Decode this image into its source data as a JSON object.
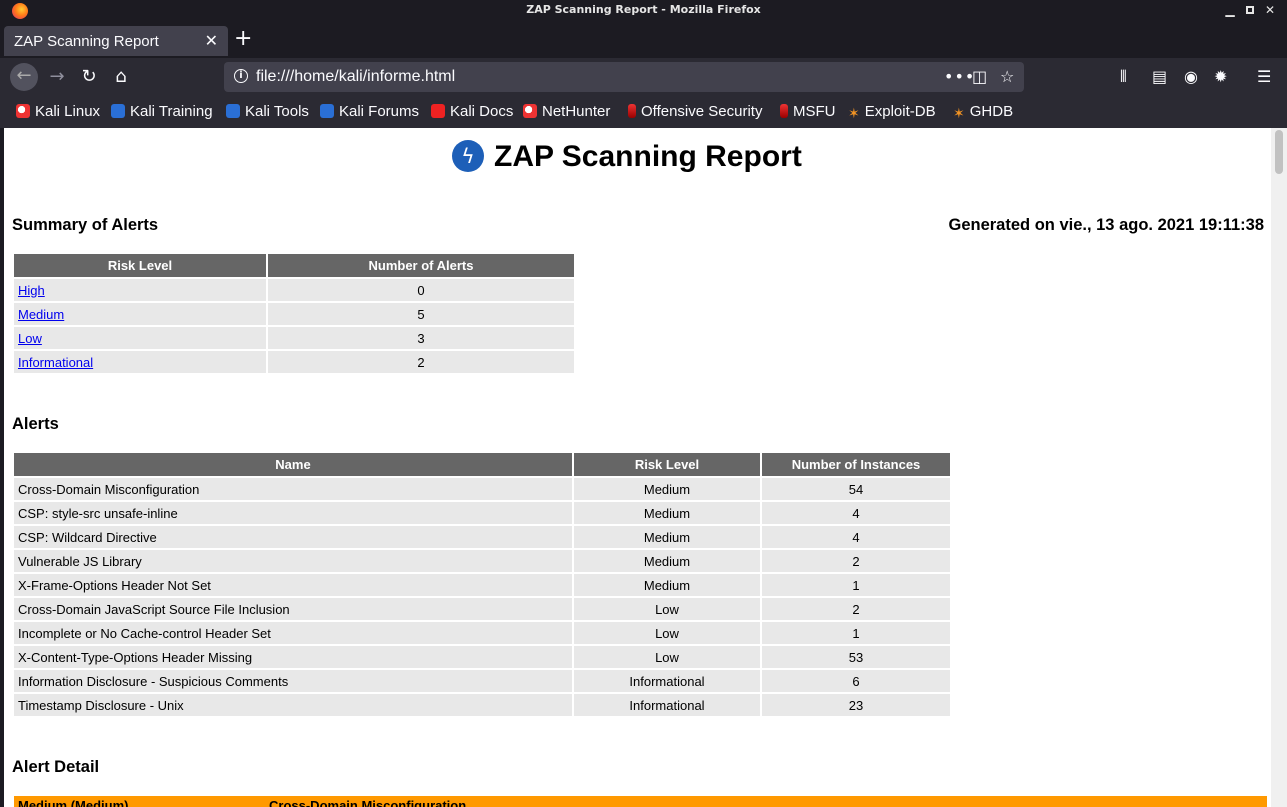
{
  "window": {
    "title": "ZAP Scanning Report - Mozilla Firefox"
  },
  "tabs": [
    {
      "label": "ZAP Scanning Report"
    }
  ],
  "address_bar": {
    "url": "file:///home/kali/informe.html"
  },
  "bookmarks": [
    {
      "label": "Kali Linux",
      "icon": "kali-dragon-icon"
    },
    {
      "label": "Kali Training",
      "icon": "kali-training-icon"
    },
    {
      "label": "Kali Tools",
      "icon": "kali-tools-icon"
    },
    {
      "label": "Kali Forums",
      "icon": "kali-forums-icon"
    },
    {
      "label": "Kali Docs",
      "icon": "kali-docs-icon"
    },
    {
      "label": "NetHunter",
      "icon": "nethunter-icon"
    },
    {
      "label": "Offensive Security",
      "icon": "offsec-icon"
    },
    {
      "label": "MSFU",
      "icon": "msfu-icon"
    },
    {
      "label": "Exploit-DB",
      "icon": "exploit-db-icon"
    },
    {
      "label": "GHDB",
      "icon": "ghdb-icon"
    }
  ],
  "report": {
    "title": "ZAP Scanning Report",
    "summary_heading": "Summary of Alerts",
    "generated": "Generated on vie., 13 ago. 2021 19:11:38",
    "summary_table": {
      "headers": [
        "Risk Level",
        "Number of Alerts"
      ],
      "rows": [
        {
          "risk": "High",
          "count": "0"
        },
        {
          "risk": "Medium",
          "count": "5"
        },
        {
          "risk": "Low",
          "count": "3"
        },
        {
          "risk": "Informational",
          "count": "2"
        }
      ]
    },
    "alerts_heading": "Alerts",
    "alerts_table": {
      "headers": [
        "Name",
        "Risk Level",
        "Number of Instances"
      ],
      "rows": [
        {
          "name": "Cross-Domain Misconfiguration",
          "risk": "Medium",
          "instances": "54"
        },
        {
          "name": "CSP: style-src unsafe-inline",
          "risk": "Medium",
          "instances": "4"
        },
        {
          "name": "CSP: Wildcard Directive",
          "risk": "Medium",
          "instances": "4"
        },
        {
          "name": "Vulnerable JS Library",
          "risk": "Medium",
          "instances": "2"
        },
        {
          "name": "X-Frame-Options Header Not Set",
          "risk": "Medium",
          "instances": "1"
        },
        {
          "name": "Cross-Domain JavaScript Source File Inclusion",
          "risk": "Low",
          "instances": "2"
        },
        {
          "name": "Incomplete or No Cache-control Header Set",
          "risk": "Low",
          "instances": "1"
        },
        {
          "name": "X-Content-Type-Options Header Missing",
          "risk": "Low",
          "instances": "53"
        },
        {
          "name": "Information Disclosure - Suspicious Comments",
          "risk": "Informational",
          "instances": "6"
        },
        {
          "name": "Timestamp Disclosure - Unix",
          "risk": "Informational",
          "instances": "23"
        }
      ]
    },
    "detail_heading": "Alert Detail",
    "detail_bar": {
      "left": "Medium (Medium)",
      "right": "Cross-Domain Misconfiguration"
    }
  },
  "colors": {
    "table_header": "#666666",
    "table_cell": "#e8e8e8",
    "detail_bar": "#ff9900",
    "link": "#0000ee"
  }
}
